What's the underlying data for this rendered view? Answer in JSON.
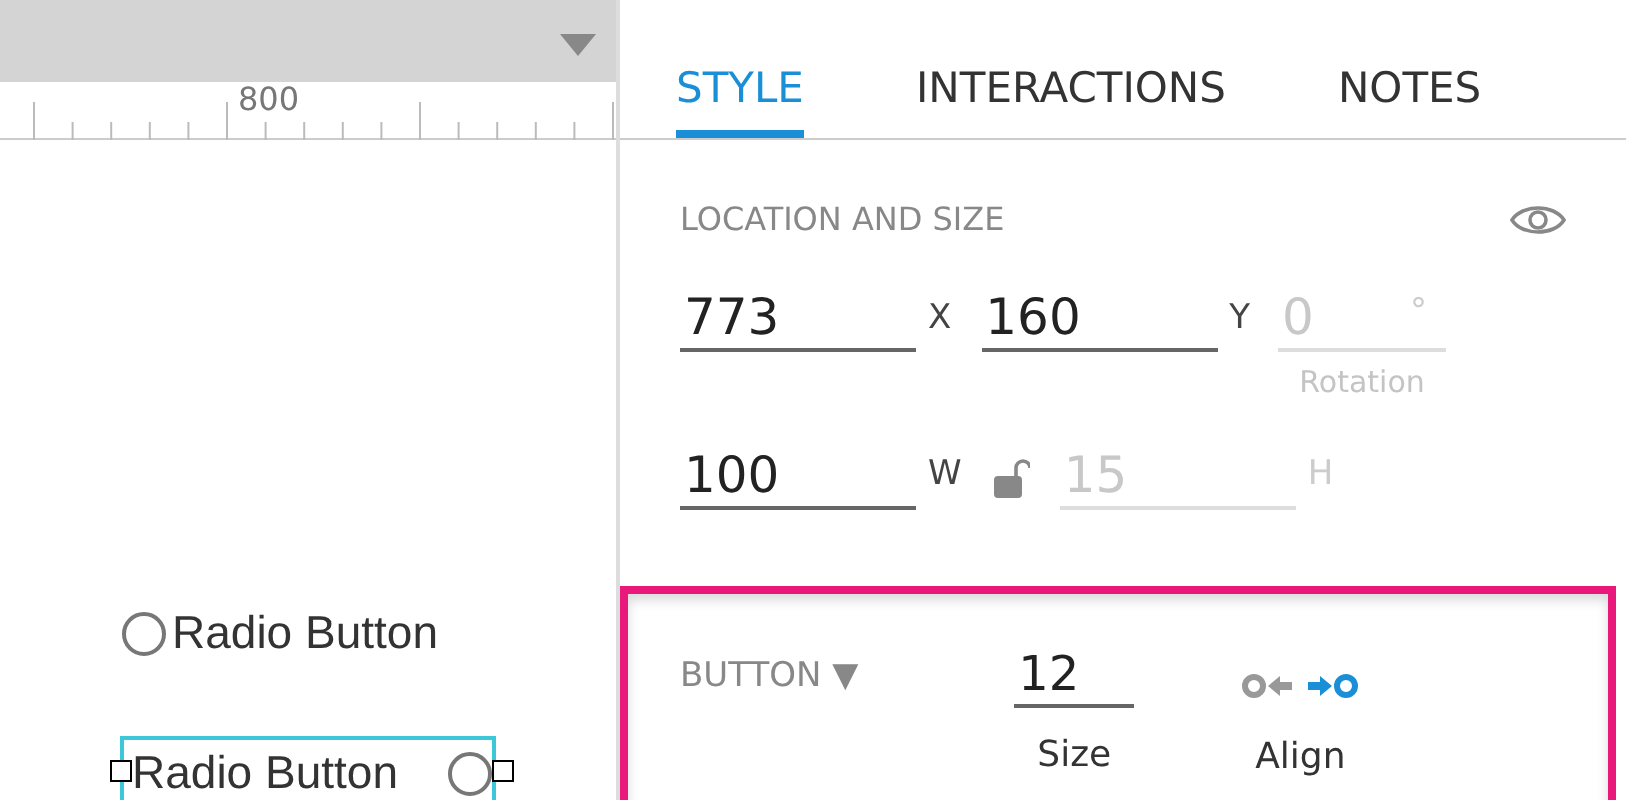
{
  "ruler": {
    "label": "800"
  },
  "canvas": {
    "radios": [
      {
        "label": "Radio Button",
        "selected": false,
        "kind": "left"
      },
      {
        "label": "Radio Button",
        "selected": true,
        "kind": "right"
      }
    ]
  },
  "tabs": [
    {
      "label": "STYLE",
      "selected": true
    },
    {
      "label": "INTERACTIONS",
      "selected": false
    },
    {
      "label": "NOTES",
      "selected": false
    }
  ],
  "location": {
    "title": "LOCATION AND SIZE",
    "rows": [
      [
        {
          "value": "773",
          "unit": "X",
          "disabled": false
        },
        {
          "value": "160",
          "unit": "Y",
          "disabled": false
        },
        {
          "value": "0",
          "unit": "°",
          "caption": "Rotation",
          "disabled": true
        }
      ],
      [
        {
          "value": "100",
          "unit": "W",
          "disabled": false,
          "lock": true
        },
        {
          "value": "15",
          "unit": "H",
          "disabled": true
        }
      ]
    ]
  },
  "button_section": {
    "title": "BUTTON",
    "caret": "▼",
    "size": {
      "value": "12",
      "caption": "Size"
    },
    "align": {
      "caption": "Align",
      "options": [
        {
          "kind": "left",
          "selected": false
        },
        {
          "kind": "right",
          "selected": true
        }
      ]
    }
  }
}
